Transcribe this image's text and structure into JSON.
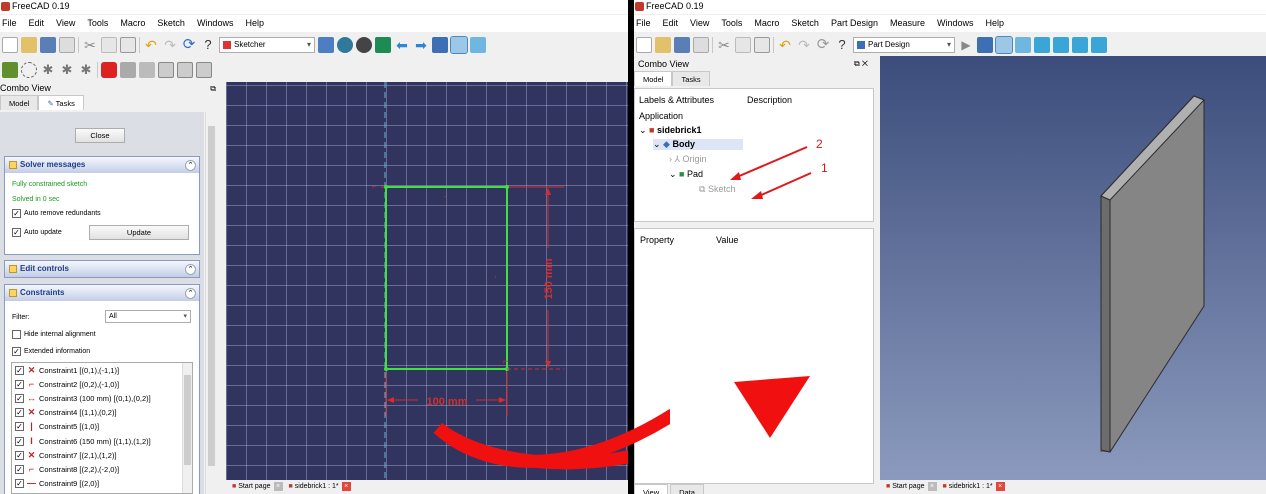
{
  "left": {
    "title": "FreeCAD 0.19",
    "menu": [
      "File",
      "Edit",
      "View",
      "Tools",
      "Macro",
      "Sketch",
      "Windows",
      "Help"
    ],
    "workbench": "Sketcher",
    "combo_title": "Combo View",
    "tabs": [
      "Model",
      "Tasks"
    ],
    "close_label": "Close",
    "solver": {
      "header": "Solver messages",
      "status": "Fully constrained sketch",
      "time": "Solved in 0 sec",
      "auto_remove": "Auto remove redundants",
      "auto_update": "Auto update",
      "update": "Update"
    },
    "edit_header": "Edit controls",
    "constraints": {
      "header": "Constraints",
      "filter_label": "Filter:",
      "filter_value": "All",
      "hide_internal": "Hide internal alignment",
      "extended": "Extended information",
      "items": [
        {
          "icon": "coincident-icon",
          "glyph": "✕",
          "label": "Constraint1 [(0,1),(-1,1)]"
        },
        {
          "icon": "point-on-object-icon",
          "glyph": "⌐",
          "label": "Constraint2 [(0,2),(-1,0)]"
        },
        {
          "icon": "horizontal-distance-icon",
          "glyph": "↔",
          "label": "Constraint3 (100 mm) [(0,1),(0,2)]"
        },
        {
          "icon": "coincident-icon",
          "glyph": "✕",
          "label": "Constraint4 [(1,1),(0,2)]"
        },
        {
          "icon": "vertical-icon",
          "glyph": "|",
          "label": "Constraint5 [(1,0)]"
        },
        {
          "icon": "vertical-distance-icon",
          "glyph": "I",
          "label": "Constraint6 (150 mm) [(1,1),(1,2)]"
        },
        {
          "icon": "coincident-icon",
          "glyph": "✕",
          "label": "Constraint7 [(2,1),(1,2)]"
        },
        {
          "icon": "point-on-object-icon",
          "glyph": "⌐",
          "label": "Constraint8 [(2,2),(-2,0)]"
        },
        {
          "icon": "horizontal-icon",
          "glyph": "—",
          "label": "Constraint9 [(2,0)]"
        }
      ]
    },
    "dim_h": "100 mm",
    "dim_v": "150 mm",
    "doc_tabs": [
      "Start page",
      "sidebrick1 : 1*"
    ]
  },
  "right": {
    "title": "FreeCAD 0.19",
    "menu": [
      "File",
      "Edit",
      "View",
      "Tools",
      "Macro",
      "Sketch",
      "Part Design",
      "Measure",
      "Windows",
      "Help"
    ],
    "workbench": "Part Design",
    "combo_title": "Combo View",
    "tabs": [
      "Model",
      "Tasks"
    ],
    "tree_cols": [
      "Labels & Attributes",
      "Description"
    ],
    "application": "Application",
    "tree": {
      "doc": "sidebrick1",
      "body": "Body",
      "origin": "Origin",
      "pad": "Pad",
      "sketch": "Sketch"
    },
    "prop_cols": [
      "Property",
      "Value"
    ],
    "view_tabs": [
      "View",
      "Data"
    ],
    "doc_tabs": [
      "Start page",
      "sidebrick1 : 1*"
    ],
    "annotations": {
      "n1": "1",
      "n2": "2"
    }
  }
}
